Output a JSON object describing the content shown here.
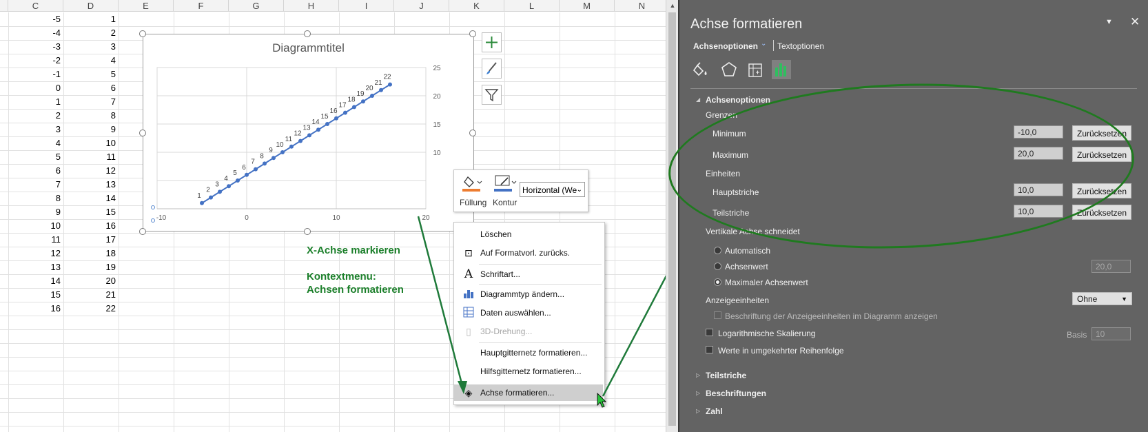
{
  "sheet": {
    "columns": [
      "C",
      "D",
      "E",
      "F",
      "G",
      "H",
      "I",
      "J",
      "K",
      "L",
      "M",
      "N"
    ],
    "col_c": [
      "-5",
      "-4",
      "-3",
      "-2",
      "-1",
      "0",
      "1",
      "2",
      "3",
      "4",
      "5",
      "6",
      "7",
      "8",
      "9",
      "10",
      "11",
      "12",
      "13",
      "14",
      "15",
      "16"
    ],
    "col_d": [
      "1",
      "2",
      "3",
      "4",
      "5",
      "6",
      "7",
      "8",
      "9",
      "10",
      "11",
      "12",
      "13",
      "14",
      "15",
      "16",
      "17",
      "18",
      "19",
      "20",
      "21",
      "22"
    ]
  },
  "chart": {
    "title": "Diagrammtitel",
    "side_buttons": [
      "plus-icon",
      "brush-icon",
      "filter-icon"
    ]
  },
  "chart_data": {
    "type": "scatter",
    "title": "Diagrammtitel",
    "x": [
      -5,
      -4,
      -3,
      -2,
      -1,
      0,
      1,
      2,
      3,
      4,
      5,
      6,
      7,
      8,
      9,
      10,
      11,
      12,
      13,
      14,
      15,
      16
    ],
    "y": [
      1,
      2,
      3,
      4,
      5,
      6,
      7,
      8,
      9,
      10,
      11,
      12,
      13,
      14,
      15,
      16,
      17,
      18,
      19,
      20,
      21,
      22
    ],
    "data_labels": [
      "1",
      "2",
      "3",
      "4",
      "5",
      "6",
      "7",
      "8",
      "9",
      "10",
      "11",
      "12",
      "13",
      "14",
      "15",
      "16",
      "17",
      "18",
      "19",
      "20",
      "21",
      "22"
    ],
    "xlim": [
      -10,
      20
    ],
    "ylim": [
      0,
      25
    ],
    "x_ticks": [
      "-10",
      "0",
      "10",
      "20"
    ],
    "y_ticks": [
      "25",
      "20",
      "15",
      "10"
    ],
    "grid": true,
    "series_color": "#4472c4"
  },
  "annotations": {
    "line1": "X-Achse markieren",
    "line2": "Kontextmenu:",
    "line3": "Achsen formatieren"
  },
  "minibar": {
    "fill_label": "Füllung",
    "outline_label": "Kontur",
    "selector_value": "Horizontal (We"
  },
  "context_menu": {
    "items": [
      {
        "label": "Löschen",
        "icon": ""
      },
      {
        "label": "Auf Formatvorl. zurücks.",
        "icon": "reset-style-icon"
      },
      {
        "label": "Schriftart...",
        "icon": "font-icon"
      },
      {
        "label": "Diagrammtyp ändern...",
        "icon": "chart-type-icon"
      },
      {
        "label": "Daten auswählen...",
        "icon": "select-data-icon"
      },
      {
        "label": "3D-Drehung...",
        "icon": "3d-rotation-icon"
      },
      {
        "label": "Hauptgitternetz formatieren...",
        "icon": ""
      },
      {
        "label": "Hilfsgitternetz formatieren...",
        "icon": ""
      },
      {
        "label": "Achse formatieren...",
        "icon": "format-axis-icon"
      }
    ]
  },
  "pane": {
    "title": "Achse formatieren",
    "tab_axis": "Achsenoptionen",
    "tab_text": "Textoptionen",
    "section_axis": "Achsenoptionen",
    "bounds": "Grenzen",
    "minimum_label": "Minimum",
    "minimum_value": "-10,0",
    "maximum_label": "Maximum",
    "maximum_value": "20,0",
    "reset": "Zurücksetzen",
    "units": "Einheiten",
    "major_label": "Hauptstriche",
    "major_value": "10,0",
    "minor_label": "Teilstriche",
    "minor_value": "10,0",
    "vertical_cross": "Vertikale Achse schneidet",
    "auto": "Automatisch",
    "axis_value": "Achsenwert",
    "axis_value_input": "20,0",
    "max_axis_value": "Maximaler Achsenwert",
    "display_units": "Anzeigeeinheiten",
    "display_units_value": "Ohne",
    "show_units_label": "Beschriftung der Anzeigeeinheiten im Diagramm anzeigen",
    "log_scale": "Logarithmische Skalierung",
    "base_label": "Basis",
    "base_value": "10",
    "reverse": "Werte in umgekehrter Reihenfolge",
    "sec_ticks": "Teilstriche",
    "sec_labels": "Beschriftungen",
    "sec_number": "Zahl"
  }
}
